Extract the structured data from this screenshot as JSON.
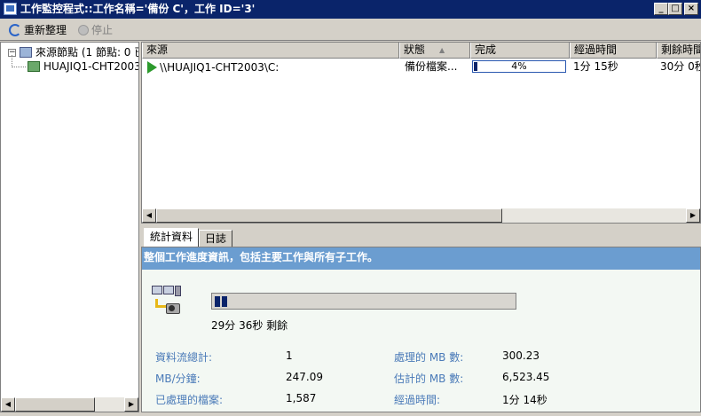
{
  "window": {
    "title": "工作監控程式::工作名稱='備份 C'，工作 ID='3'",
    "minimize": "_",
    "maximize": "□",
    "close": "×"
  },
  "toolbar": {
    "refresh_label": "重新整理",
    "stop_label": "停止"
  },
  "tree": {
    "root_label": "來源節點 (1 節點: 0 已",
    "root_expander": "−",
    "child_label": "HUAJIQ1-CHT2003"
  },
  "list": {
    "columns": [
      "來源",
      "狀態",
      "完成",
      "經過時間",
      "剩餘時間"
    ],
    "sort_indicator": "▲",
    "rows": [
      {
        "source": "\\\\HUAJIQ1-CHT2003\\C:",
        "status": "備份檔案...",
        "complete_text": "4%",
        "complete": 4,
        "elapsed": "1分 15秒",
        "remaining": "30分 0秒"
      }
    ]
  },
  "tabs": [
    "統計資料",
    "日誌"
  ],
  "stats": {
    "banner": "整個工作進度資訊，包括主要工作與所有子工作。",
    "progress": 4,
    "remaining_text": "29分 36秒 剩餘",
    "labels": {
      "throughput": "資料流總計:",
      "rate": "MB/分鐘:",
      "files": "已處理的檔案:",
      "processed_mb": "處理的 MB 數:",
      "estimated_mb": "估計的 MB 數:",
      "elapsed": "經過時間:"
    },
    "values": {
      "throughput": "1",
      "rate": "247.09",
      "files": "1,587",
      "processed_mb": "300.23",
      "estimated_mb": "6,523.45",
      "elapsed": "1分 14秒"
    }
  },
  "scroll": {
    "left": "◀",
    "right": "▶"
  }
}
